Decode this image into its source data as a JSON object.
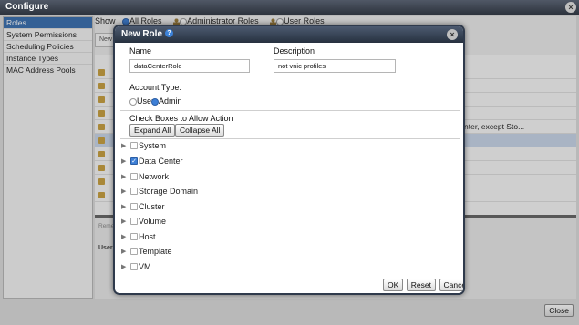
{
  "window": {
    "title": "Configure",
    "close_label": "×"
  },
  "sidebar": {
    "items": [
      {
        "label": "Roles",
        "active": true
      },
      {
        "label": "System Permissions"
      },
      {
        "label": "Scheduling Policies"
      },
      {
        "label": "Instance Types"
      },
      {
        "label": "MAC Address Pools"
      }
    ]
  },
  "main": {
    "show_label": "Show",
    "filters": [
      {
        "label": "All Roles",
        "selected": true
      },
      {
        "label": "Administrator Roles",
        "selected": false
      },
      {
        "label": "User Roles",
        "selected": false
      }
    ],
    "new_button": "New",
    "visible_row_text": "nter, except Sto...",
    "bottom_tab": "Reme",
    "bottom_header": "User"
  },
  "footer": {
    "close_label": "Close"
  },
  "dialog": {
    "title": "New Role",
    "help_icon": "?",
    "close_label": "×",
    "name_label": "Name",
    "name_value": "dataCenterRole",
    "description_label": "Description",
    "description_value": "not vnic profiles",
    "account_type_label": "Account Type:",
    "account_types": [
      {
        "label": "User",
        "selected": false
      },
      {
        "label": "Admin",
        "selected": true
      }
    ],
    "check_boxes_label": "Check Boxes to Allow Action",
    "expand_all": "Expand All",
    "collapse_all": "Collapse All",
    "tree": [
      {
        "label": "System",
        "checked": false
      },
      {
        "label": "Data Center",
        "checked": true
      },
      {
        "label": "Network",
        "checked": false
      },
      {
        "label": "Storage Domain",
        "checked": false
      },
      {
        "label": "Cluster",
        "checked": false
      },
      {
        "label": "Volume",
        "checked": false
      },
      {
        "label": "Host",
        "checked": false
      },
      {
        "label": "Template",
        "checked": false
      },
      {
        "label": "VM",
        "checked": false
      }
    ],
    "ok": "OK",
    "reset": "Reset",
    "cancel": "Cancel"
  },
  "colors": {
    "accent": "#3d7fd6",
    "titlebar": "#2d333d",
    "selection": "#3a6fb0"
  }
}
